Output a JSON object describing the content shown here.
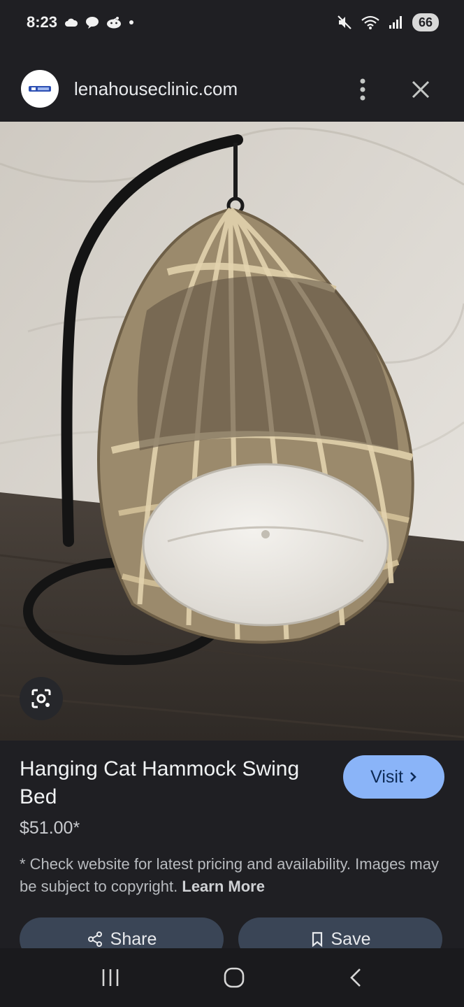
{
  "status_bar": {
    "time": "8:23",
    "left_icons": [
      "cloud-icon",
      "chat-bubble-icon",
      "reddit-icon",
      "dot-icon"
    ],
    "right_icons": [
      "mute-icon",
      "wifi-6e-icon",
      "signal-icon"
    ],
    "battery": "66"
  },
  "header": {
    "site": "lenahouseclinic.com",
    "favicon": "site-logo-icon"
  },
  "product": {
    "title": "Hanging Cat Hammock Swing Bed",
    "price": "$51.00*",
    "visit_label": "Visit",
    "disclaimer": "* Check website for latest pricing and availability. Images may be subject to copyright.",
    "learn_more": "Learn More"
  },
  "actions": {
    "share_label": "Share",
    "save_label": "Save"
  },
  "colors": {
    "background": "#1f1f23",
    "accent": "#8ab4f8",
    "action_button": "#3a4556"
  },
  "nav": {
    "icons": [
      "recent-apps-icon",
      "home-icon",
      "back-icon"
    ]
  }
}
